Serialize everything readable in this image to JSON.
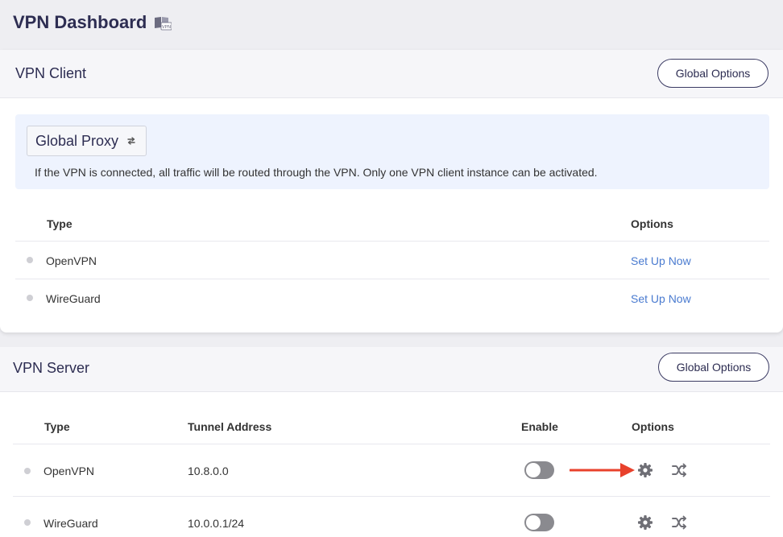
{
  "page": {
    "title": "VPN Dashboard",
    "title_icon": "vpn-book-icon"
  },
  "client": {
    "title": "VPN Client",
    "global_options_label": "Global Options",
    "proxy": {
      "mode": "Global Proxy",
      "swap_icon": "swap-arrows-icon",
      "description": "If the VPN is connected, all traffic will be routed through the VPN. Only one VPN client instance can be activated."
    },
    "table": {
      "headers": {
        "type": "Type",
        "options": "Options"
      },
      "rows": [
        {
          "type": "OpenVPN",
          "action": "Set Up Now"
        },
        {
          "type": "WireGuard",
          "action": "Set Up Now"
        }
      ]
    }
  },
  "server": {
    "title": "VPN Server",
    "global_options_label": "Global Options",
    "table": {
      "headers": {
        "type": "Type",
        "tunnel": "Tunnel Address",
        "enable": "Enable",
        "options": "Options"
      },
      "rows": [
        {
          "type": "OpenVPN",
          "tunnel": "10.8.0.0",
          "enabled": false,
          "icons": [
            "gear-icon",
            "shuffle-icon"
          ]
        },
        {
          "type": "WireGuard",
          "tunnel": "10.0.0.1/24",
          "enabled": false,
          "icons": [
            "gear-icon",
            "shuffle-icon"
          ]
        }
      ]
    }
  },
  "colors": {
    "accent_text": "#2d2d52",
    "link": "#4a7bd0",
    "annotation_arrow": "#e8412c",
    "toggle_off": "#8a8a8f"
  }
}
